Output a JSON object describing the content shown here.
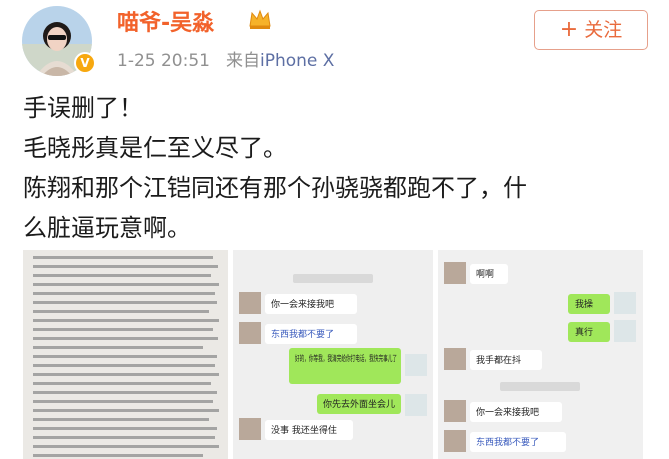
{
  "user": {
    "name": "喵爷-吴淼",
    "timestamp": "1-25 20:51",
    "source_prefix": "来自",
    "device": "iPhone X",
    "verified_mark": "V"
  },
  "follow_button": {
    "plus": "+",
    "label": "关注"
  },
  "post": {
    "lines": [
      "手误删了！",
      "毛晓彤真是仁至义尽了。",
      "陈翔和那个江铠同还有那个孙骁骁都跑不了，什",
      "么脏逼玩意啊。"
    ]
  },
  "images": {
    "chat_left": {
      "bubbles": [
        "你一会来接我吧",
        "东西我都不要了",
        "好的，你等我，我清完给你打电话，我快完事儿了",
        "你先去外面坐会儿",
        "没事  我还坐得住"
      ]
    },
    "chat_right": {
      "bubbles": [
        "啊啊",
        "我操",
        "真行",
        "我手都在抖",
        "你一会来接我吧",
        "东西我都不要了"
      ]
    }
  }
}
